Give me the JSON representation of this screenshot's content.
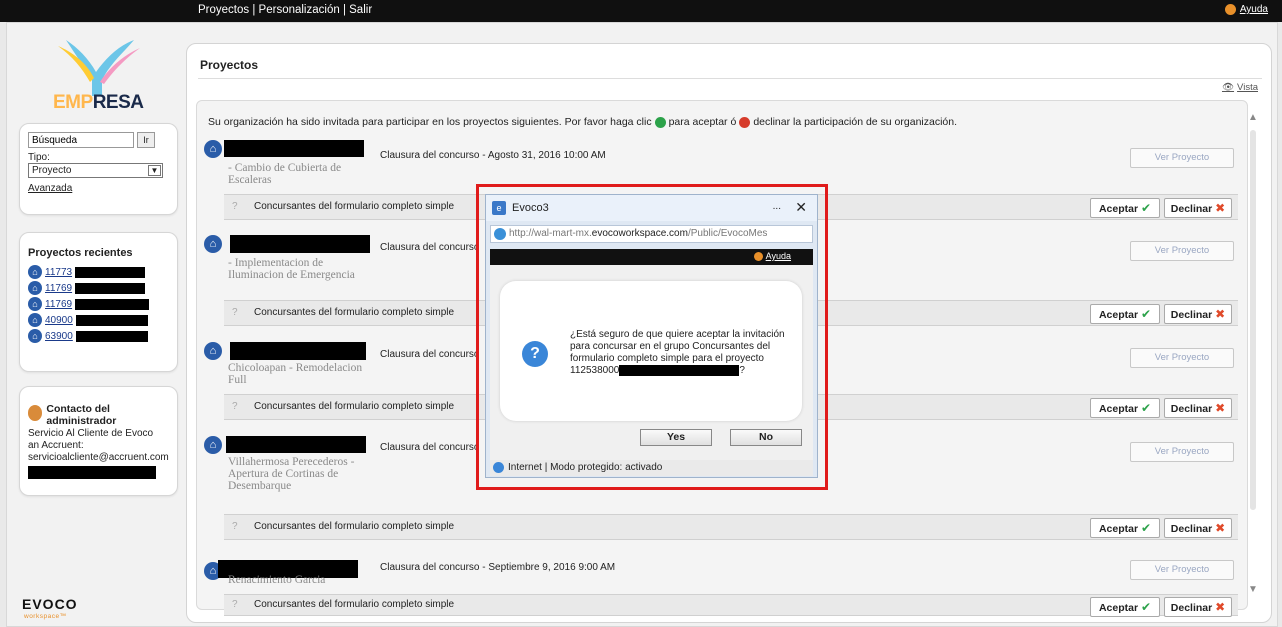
{
  "topbar": {
    "nav": [
      "Proyectos",
      "Personalización",
      "Salir"
    ],
    "separator": "|",
    "help": "Ayuda"
  },
  "logo": {
    "text_a": "EMP",
    "text_b": "RESA"
  },
  "search": {
    "value": "Búsqueda",
    "go": "Ir",
    "type_label": "Tipo:",
    "type_value": "Proyecto",
    "advanced": "Avanzada"
  },
  "recent": {
    "title": "Proyectos recientes",
    "items": [
      "11773",
      "11769",
      "11769",
      "40900",
      "63900"
    ]
  },
  "contact": {
    "title": "Contacto del administrador",
    "lines": [
      "Servicio Al Cliente de Evoco",
      "an Accruent:",
      "servicioalcliente@accruent.com"
    ]
  },
  "brand": {
    "name": "EVOCO",
    "sub": "workspace™"
  },
  "main": {
    "title": "Proyectos",
    "view_link": "Vista",
    "intro_a": "Su organización ha sido invitada para participar en los proyectos siguientes. Por favor haga clic",
    "intro_b": "para aceptar ó",
    "intro_c": "declinar la participación de su organización."
  },
  "projects": [
    {
      "name": "- Cambio de Cubierta de Escaleras",
      "closing": "Clausura del concurso - Agosto 31, 2016 10:00 AM",
      "view": "Ver Proyecto",
      "group": "Concursantes del formulario completo simple",
      "accept": "Aceptar",
      "decline": "Declinar"
    },
    {
      "name": "- Implementacion de Iluminacion de Emergencia",
      "closing": "Clausura del concurso",
      "view": "Ver Proyecto",
      "group": "Concursantes del formulario completo simple",
      "accept": "Aceptar",
      "decline": "Declinar"
    },
    {
      "name": "Chicoloapan - Remodelacion Full",
      "closing": "Clausura del concurso",
      "view": "Ver Proyecto",
      "group": "Concursantes del formulario completo simple",
      "accept": "Aceptar",
      "decline": "Declinar"
    },
    {
      "name": "Villahermosa Perecederos - Apertura de Cortinas de Desembarque",
      "closing": "Clausura del concurso",
      "view": "Ver Proyecto",
      "group": "Concursantes del formulario completo simple",
      "accept": "Aceptar",
      "decline": "Declinar"
    },
    {
      "name": "Renacimiento Garcia",
      "closing": "Clausura del concurso - Septiembre 9, 2016 9:00 AM",
      "view": "Ver Proyecto",
      "group": "Concursantes del formulario completo simple",
      "accept": "Aceptar",
      "decline": "Declinar"
    }
  ],
  "dialog": {
    "title": "Evoco3",
    "more": "...",
    "url_a": "http://wal-mart-mx.",
    "url_b": "evocoworkspace.com",
    "url_c": "/Public/EvocoMes",
    "help": "Ayuda",
    "message": "¿Está seguro de que quiere aceptar la invitación para concursar en el grupo Concursantes del formulario completo simple para el proyecto",
    "project_number": "112538000",
    "question_end": "?",
    "yes": "Yes",
    "no": "No",
    "status": "Internet | Modo protegido: activado"
  },
  "colors": {
    "accept": "#2ca24a",
    "decline": "#d63b2b",
    "highlight": "#e01b1b"
  }
}
